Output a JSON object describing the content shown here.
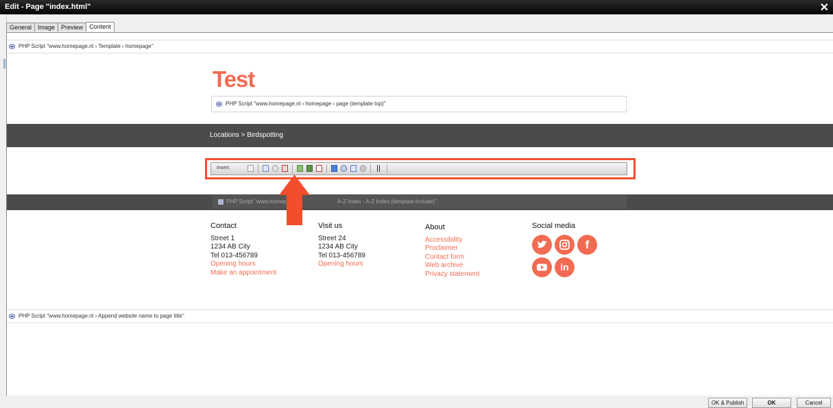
{
  "window": {
    "title": "Edit - Page \"index.html\"",
    "close_glyph": "✕"
  },
  "tabs": [
    {
      "label": "General"
    },
    {
      "label": "Image"
    },
    {
      "label": "Preview"
    },
    {
      "label": "Content",
      "active": true
    }
  ],
  "editor": {
    "top_script": "PHP Script \"www.homepage.nl › Template › homepage\"",
    "heading": "Test",
    "template_top_script": "PHP Script \"www.homepage.nl › homepage › page (template top)\"",
    "breadcrumb": "Locations > Birdspotting",
    "toolbar_label": "Insert:",
    "include_script_visible_start": "PHP Script \"www.homepa",
    "include_script_visible_end": "A-Z Index - A-Z Index (template include)\"",
    "bottom_script": "PHP Script \"www.homepage.nl › Append website name to page title\""
  },
  "footer": {
    "contact": {
      "heading": "Contact",
      "lines": [
        "Street 1",
        "1234 AB City",
        "Tel 013-456789"
      ],
      "links": [
        "Opening hours",
        "Make an appointment"
      ]
    },
    "visit": {
      "heading": "Visit us",
      "lines": [
        "Street 24",
        "1234 AB  City",
        "Tel 013-456789"
      ],
      "links": [
        "Opening hours"
      ]
    },
    "about": {
      "heading": "About",
      "links": [
        "Accessibility",
        "Proclaimer",
        "Contact form",
        "Web archive",
        "Privacy statement"
      ]
    },
    "social": {
      "heading": "Social media",
      "icons": [
        "twitter-icon",
        "instagram-icon",
        "facebook-icon",
        "youtube-icon",
        "linkedin-icon"
      ],
      "facebook_glyph": "f",
      "linkedin_glyph": "in"
    }
  },
  "buttons": {
    "ok_publish": "OK & Publish",
    "ok": "OK",
    "cancel": "Cancel"
  },
  "colors": {
    "accent": "#f26b52",
    "band": "#4b4b4b",
    "highlight": "#f24e2d"
  }
}
